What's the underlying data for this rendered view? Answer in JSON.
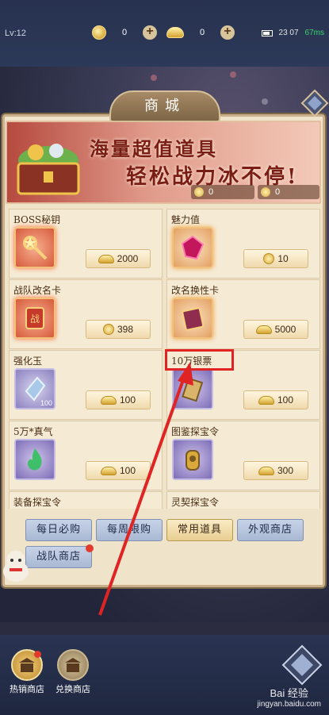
{
  "status_bar": {
    "level": "Lv:12",
    "coins": "0",
    "ingots": "0",
    "time": "23 07",
    "latency": "67ms"
  },
  "shop": {
    "title": "商城",
    "banner": {
      "line1": "海量超值道具",
      "line2": "轻松战力冰不停!",
      "coin_balance": "0",
      "token_balance": "0"
    },
    "items": [
      {
        "name": "BOSS秘钥",
        "price": "2000",
        "currency": "ingot",
        "thumb": "key-icon"
      },
      {
        "name": "魅力值",
        "price": "10",
        "currency": "coin",
        "thumb": "gem-icon"
      },
      {
        "name": "战队改名卡",
        "price": "398",
        "currency": "coin",
        "thumb": "scroll-icon"
      },
      {
        "name": "改名换性卡",
        "price": "5000",
        "currency": "ingot",
        "thumb": "book-icon"
      },
      {
        "name": "强化玉",
        "price": "100",
        "currency": "ingot",
        "thumb": "jade-icon",
        "count": "100"
      },
      {
        "name": "10万银票",
        "price": "100",
        "currency": "ingot",
        "thumb": "banknote-icon"
      },
      {
        "name": "5万*真气",
        "price": "100",
        "currency": "ingot",
        "thumb": "flame-icon"
      },
      {
        "name": "图鉴探宝令",
        "price": "300",
        "currency": "ingot",
        "thumb": "token-icon"
      },
      {
        "name": "装备探宝令"
      },
      {
        "name": "灵契探宝令"
      }
    ],
    "tabs": [
      "每日必购",
      "每周限购",
      "常用道具",
      "外观商店",
      "战队商店"
    ],
    "active_tab": "常用道具"
  },
  "bottom_nav": {
    "hot_shop": "热销商店",
    "exchange_shop": "兑换商店"
  },
  "watermark": {
    "brand": "Bai 经验",
    "url": "jingyan.baidu.com"
  },
  "colors": {
    "panel": "#efe3c9",
    "banner_red": "#b64a3f",
    "active_tab": "#e7cd90",
    "annotation": "#e02424"
  }
}
